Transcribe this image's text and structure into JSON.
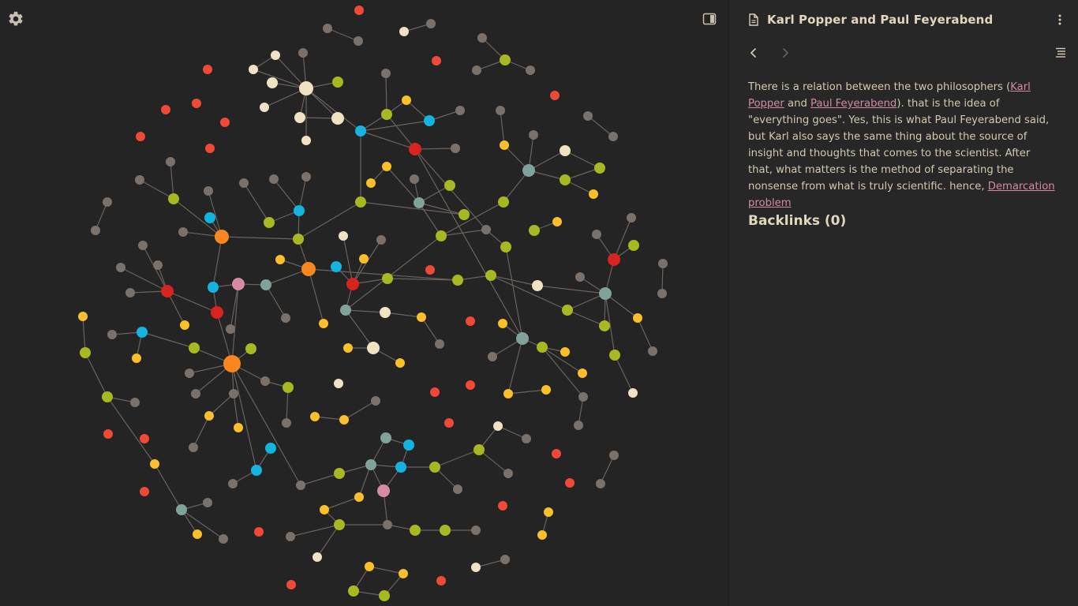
{
  "graph": {
    "settings_icon": "gear-icon",
    "toggle_icon": "sidebar-toggle-icon",
    "colors": {
      "edge": "#6b625d",
      "gray": "#7b716b",
      "olive": "#a8b823",
      "yellow": "#fbbf2c",
      "cream": "#efe3c3",
      "red": "#d8241f",
      "orange_red": "#f04a37",
      "cyan": "#13b4e0",
      "teal": "#7fa29b",
      "orange": "#f9861e",
      "pink": "#d68aa5"
    }
  },
  "note": {
    "title": "Karl Popper and Paul Feyerabend",
    "title_icon": "document-icon",
    "more_icon": "more-vertical-icon",
    "back_icon": "chevron-left-icon",
    "forward_icon": "chevron-right-icon",
    "outline_icon": "outline-icon",
    "body": {
      "text_1": "There is a relation between the two philosophers (",
      "link_1": "Karl Popper",
      "text_2": " and ",
      "link_2": "Paul Feyerabend",
      "text_3": "). that is the idea of \"everything goes\". Yes, this is what Paul Feyerabend said, but Karl also says the same thing about the source of insight and thoughts that comes to the scientist. After that, what matters is the method of separating the nonsense from what is truly scientific. hence, ",
      "link_3": "Demarcation problem"
    },
    "backlinks_label": "Backlinks (0)"
  }
}
